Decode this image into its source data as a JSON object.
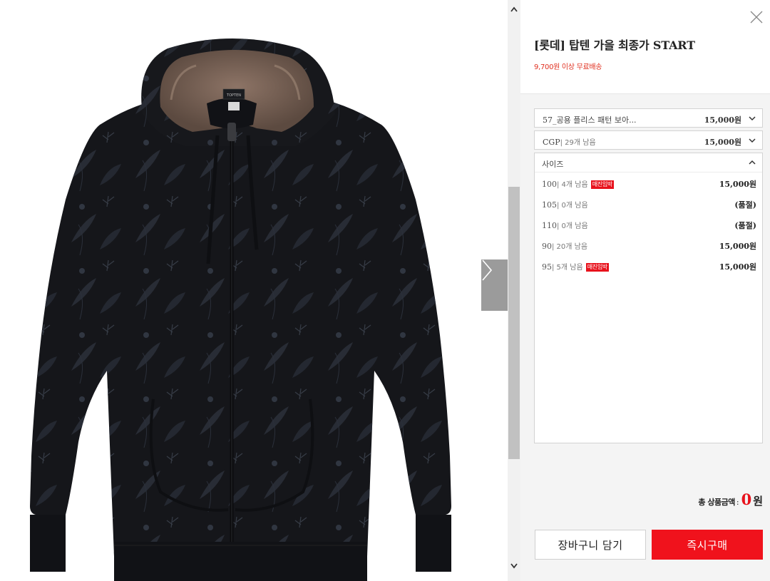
{
  "product": {
    "title": "[롯데] 탑텐 가을 최종가 START",
    "free_shipping": "9,700원 이상 무료배송",
    "image_label": "TOPTEN"
  },
  "options": {
    "selected": [
      {
        "name": "57_공용 플리스 패턴 보아...",
        "stock": "",
        "price": "15,000원"
      },
      {
        "name": "CGP",
        "stock": "| 29개 남음",
        "price": "15,000원"
      }
    ],
    "size_dropdown": {
      "label": "사이즈",
      "items": [
        {
          "size": "100",
          "stock": "| 4개 남음",
          "badge": "매진임박",
          "price": "15,000원"
        },
        {
          "size": "105",
          "stock": "| 0개 남음",
          "badge": "",
          "price": "(품절)"
        },
        {
          "size": "110",
          "stock": "| 0개 남음",
          "badge": "",
          "price": "(품절)"
        },
        {
          "size": "90",
          "stock": "| 20개 남음",
          "badge": "",
          "price": "15,000원"
        },
        {
          "size": "95",
          "stock": "| 5개 남음",
          "badge": "매진임박",
          "price": "15,000원"
        }
      ]
    }
  },
  "total": {
    "label": "총 상품금액",
    "colon": ":",
    "value": "0",
    "unit": "원"
  },
  "buttons": {
    "cart": "장바구니 담기",
    "buy": "즉시구매"
  },
  "icons": {
    "close": "close-icon",
    "next": "chevron-right-icon",
    "dropdown": "chevron-down-icon",
    "dropdown_open": "chevron-up-icon",
    "scroll_up": "scroll-up-icon",
    "scroll_down": "scroll-down-icon"
  },
  "colors": {
    "accent": "#f0121c",
    "free_shipping": "#e03020",
    "badge": "#e8121c"
  }
}
